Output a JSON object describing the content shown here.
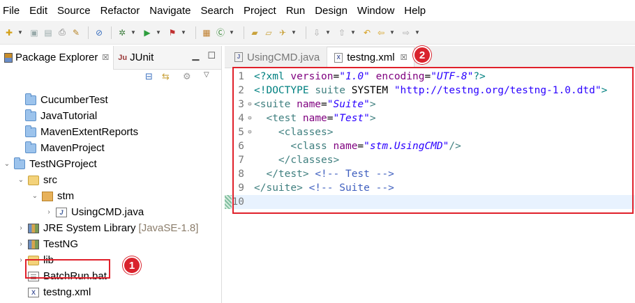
{
  "menu": [
    "File",
    "Edit",
    "Source",
    "Refactor",
    "Navigate",
    "Search",
    "Project",
    "Run",
    "Design",
    "Window",
    "Help"
  ],
  "left_panel": {
    "tabs": [
      {
        "label": "Package Explorer",
        "active": true
      },
      {
        "label": "JUnit",
        "active": false
      }
    ],
    "tree": [
      {
        "label": "CucumberTest",
        "icon": "project-folder-icon"
      },
      {
        "label": "JavaTutorial",
        "icon": "project-folder-icon"
      },
      {
        "label": "MavenExtentReports",
        "icon": "project-folder-icon"
      },
      {
        "label": "MavenProject",
        "icon": "project-folder-icon"
      },
      {
        "label": "TestNGProject",
        "icon": "project-folder-icon",
        "expanded": true
      },
      {
        "label": "src",
        "icon": "source-folder-icon",
        "expanded": true
      },
      {
        "label": "stm",
        "icon": "package-icon",
        "expanded": true
      },
      {
        "label": "UsingCMD.java",
        "icon": "java-file-icon"
      },
      {
        "label": "JRE System Library",
        "decoration": "[JavaSE-1.8]",
        "icon": "library-icon"
      },
      {
        "label": "TestNG",
        "icon": "library-icon"
      },
      {
        "label": "lib",
        "icon": "folder-icon"
      },
      {
        "label": "BatchRun.bat",
        "icon": "bat-file-icon"
      },
      {
        "label": "testng.xml",
        "icon": "xml-file-icon"
      }
    ]
  },
  "editor": {
    "tabs": [
      {
        "label": "UsingCMD.java",
        "active": false
      },
      {
        "label": "testng.xml",
        "active": true
      }
    ],
    "lines": [
      [
        {
          "t": "pi",
          "v": "<?xml "
        },
        {
          "t": "attr",
          "v": "version"
        },
        {
          "t": "plain",
          "v": "="
        },
        {
          "t": "val",
          "v": "\"1.0\""
        },
        {
          "t": "plain",
          "v": " "
        },
        {
          "t": "attr",
          "v": "encoding"
        },
        {
          "t": "plain",
          "v": "="
        },
        {
          "t": "val",
          "v": "\"UTF-8\""
        },
        {
          "t": "pi",
          "v": "?>"
        }
      ],
      [
        {
          "t": "dtd",
          "v": "<!DOCTYPE "
        },
        {
          "t": "tag",
          "v": "suite"
        },
        {
          "t": "plain",
          "v": " SYSTEM "
        },
        {
          "t": "str",
          "v": "\"http://testng.org/testng-1.0.dtd\""
        },
        {
          "t": "dtd",
          "v": ">"
        }
      ],
      [
        {
          "t": "tag",
          "v": "<suite "
        },
        {
          "t": "attr",
          "v": "name"
        },
        {
          "t": "plain",
          "v": "="
        },
        {
          "t": "val",
          "v": "\"Suite\""
        },
        {
          "t": "tag",
          "v": ">"
        }
      ],
      [
        {
          "t": "plain",
          "v": "  "
        },
        {
          "t": "tag",
          "v": "<test "
        },
        {
          "t": "attr",
          "v": "name"
        },
        {
          "t": "plain",
          "v": "="
        },
        {
          "t": "val",
          "v": "\"Test\""
        },
        {
          "t": "tag",
          "v": ">"
        }
      ],
      [
        {
          "t": "plain",
          "v": "    "
        },
        {
          "t": "tag",
          "v": "<classes>"
        }
      ],
      [
        {
          "t": "plain",
          "v": "      "
        },
        {
          "t": "tag",
          "v": "<class "
        },
        {
          "t": "attr",
          "v": "name"
        },
        {
          "t": "plain",
          "v": "="
        },
        {
          "t": "val",
          "v": "\"stm.UsingCMD\""
        },
        {
          "t": "tag",
          "v": "/>"
        }
      ],
      [
        {
          "t": "plain",
          "v": "    "
        },
        {
          "t": "tag",
          "v": "</classes>"
        }
      ],
      [
        {
          "t": "plain",
          "v": "  "
        },
        {
          "t": "tag",
          "v": "</test>"
        },
        {
          "t": "plain",
          "v": " "
        },
        {
          "t": "cmt",
          "v": "<!-- Test -->"
        }
      ],
      [
        {
          "t": "tag",
          "v": "</suite>"
        },
        {
          "t": "plain",
          "v": " "
        },
        {
          "t": "cmt",
          "v": "<!-- Suite -->"
        }
      ],
      []
    ],
    "line_numbers": [
      "1",
      "2",
      "3",
      "4",
      "5",
      "6",
      "7",
      "8",
      "9",
      "10"
    ],
    "fold_markers": [
      "",
      "",
      "⊖",
      "⊖",
      "⊖",
      "",
      "",
      "",
      "",
      ""
    ]
  },
  "annotations": {
    "badge_1": "1",
    "badge_2": "2",
    "color": "#e0202a"
  }
}
